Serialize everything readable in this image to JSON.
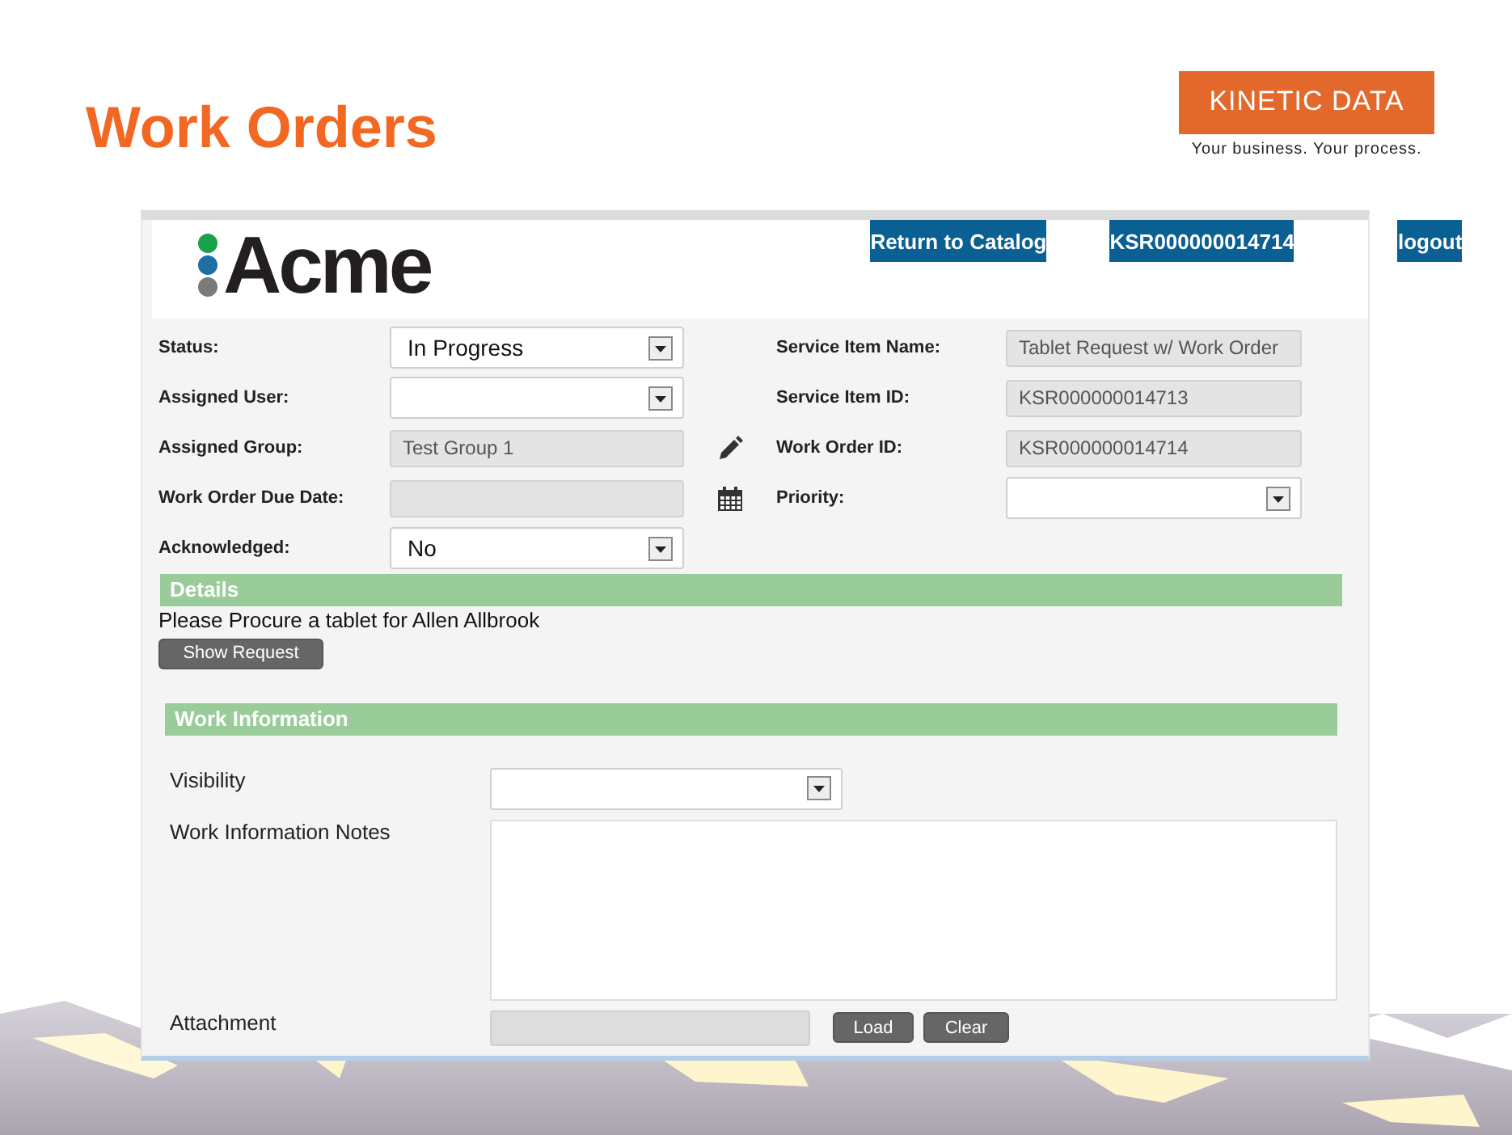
{
  "slide": {
    "title": "Work Orders",
    "brand": {
      "name": "KINETIC DATA",
      "tagline": "Your business. Your process."
    }
  },
  "app": {
    "logo": "Acme",
    "nav_buttons": [
      "Return to Catalog",
      "KSR000000014714",
      "logout"
    ],
    "left_fields": [
      {
        "label": "Status:",
        "kind": "select",
        "value": "In Progress",
        "disabled": false
      },
      {
        "label": "Assigned User:",
        "kind": "select",
        "disabled": false
      },
      {
        "label": "Assigned Group:",
        "kind": "edit",
        "value": "Test Group 1",
        "disabled": true
      },
      {
        "label": "Work Order Due Date:",
        "kind": "date",
        "disabled": true
      },
      {
        "label": "Acknowledged:",
        "kind": "select",
        "value": "No",
        "disabled": false
      }
    ],
    "right_fields": [
      {
        "label": "Service Item Name:",
        "kind": "text",
        "value": "Tablet Request w/ Work Order",
        "disabled": true
      },
      {
        "label": "Service Item ID:",
        "kind": "text",
        "value": "KSR000000014713",
        "disabled": true
      },
      {
        "label": "Work Order ID:",
        "kind": "text",
        "value": "KSR000000014714",
        "disabled": true
      },
      {
        "label": "Priority:",
        "kind": "select",
        "disabled": false
      }
    ],
    "details": {
      "heading": "Details",
      "text": "Please Procure a tablet for Allen Allbrook",
      "button": "Show Request"
    },
    "work_info": {
      "heading": "Work Information",
      "visibility_label": "Visibility",
      "notes_label": "Work Information Notes",
      "attachment_label": "Attachment",
      "buttons": [
        "Load",
        "Clear"
      ]
    }
  }
}
